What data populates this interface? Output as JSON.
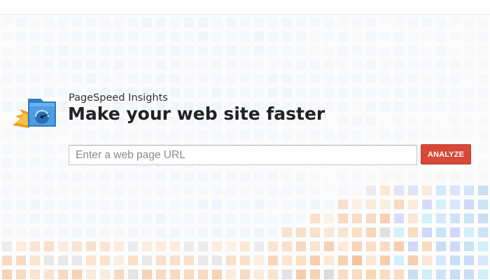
{
  "header": {
    "app_name": "PageSpeed Insights",
    "title": "Make your web site faster",
    "logo_icon": "speedometer-window-icon"
  },
  "search": {
    "placeholder": "Enter a web page URL",
    "value": "",
    "submit_label": "ANALYZE"
  },
  "colors": {
    "accent": "#d64937",
    "logo_blue": "#3f8fd8",
    "logo_flame": "#f39c1f",
    "text": "#222222"
  }
}
